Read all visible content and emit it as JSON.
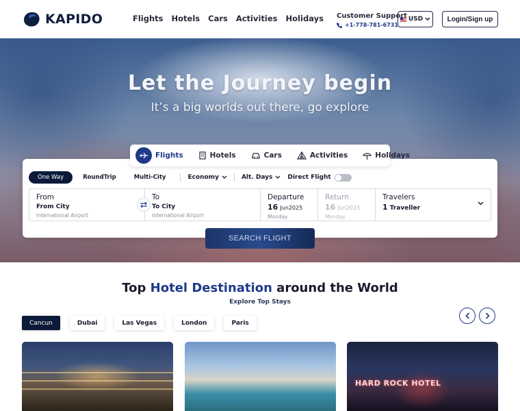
{
  "brand": {
    "name": "KAPIDO"
  },
  "nav": {
    "items": [
      "Flights",
      "Hotels",
      "Cars",
      "Activities",
      "Holidays"
    ]
  },
  "support": {
    "title": "Customer Support",
    "phone": "+1-778-781-6731"
  },
  "currency": {
    "code": "USD"
  },
  "auth": {
    "login_label": "Login/Sign up"
  },
  "hero": {
    "title": "Let the Journey begin",
    "subtitle": "It’s a big worlds out there, go explore"
  },
  "search_tabs": [
    {
      "label": "Flights",
      "icon": "plane-icon",
      "active": true
    },
    {
      "label": "Hotels",
      "icon": "hotel-icon",
      "active": false
    },
    {
      "label": "Cars",
      "icon": "car-icon",
      "active": false
    },
    {
      "label": "Activities",
      "icon": "activities-icon",
      "active": false
    },
    {
      "label": "Holidays",
      "icon": "holidays-icon",
      "active": false
    }
  ],
  "trip_types": [
    {
      "label": "One Way",
      "active": true
    },
    {
      "label": "RoundTrip",
      "active": false
    },
    {
      "label": "Multi-City",
      "active": false
    }
  ],
  "options": {
    "cabin": "Economy",
    "alt_days": "Alt. Days",
    "direct_flight": "Direct Flight",
    "direct_flight_on": false
  },
  "fields": {
    "from": {
      "label": "From",
      "value": "From City",
      "hint": "International Airport"
    },
    "to": {
      "label": "To",
      "value": "To City",
      "hint": "International Airport"
    },
    "departure": {
      "label": "Departure",
      "day": "16",
      "month_year": "Jun2025",
      "weekday": "Monday"
    },
    "return": {
      "label": "Return",
      "day": "16",
      "month_year": "Jun2025",
      "weekday": "Monday"
    },
    "travelers": {
      "label": "Travelers",
      "count": "1",
      "unit": "Traveller"
    }
  },
  "search_button": {
    "label": "SEARCH FLIGHT"
  },
  "destinations": {
    "title_pre": "Top",
    "title_highlight": "Hotel Destination",
    "title_post": "around the World",
    "subtitle": "Explore Top Stays",
    "cities": [
      {
        "label": "Cancun",
        "active": true
      },
      {
        "label": "Dubai",
        "active": false
      },
      {
        "label": "Las Vegas",
        "active": false
      },
      {
        "label": "London",
        "active": false
      },
      {
        "label": "Paris",
        "active": false
      }
    ],
    "hotel_sign": "HARD ROCK HOTEL"
  },
  "colors": {
    "primary": "#1e3a8a",
    "dark": "#0c1a3a",
    "text": "#1a1a2e"
  }
}
